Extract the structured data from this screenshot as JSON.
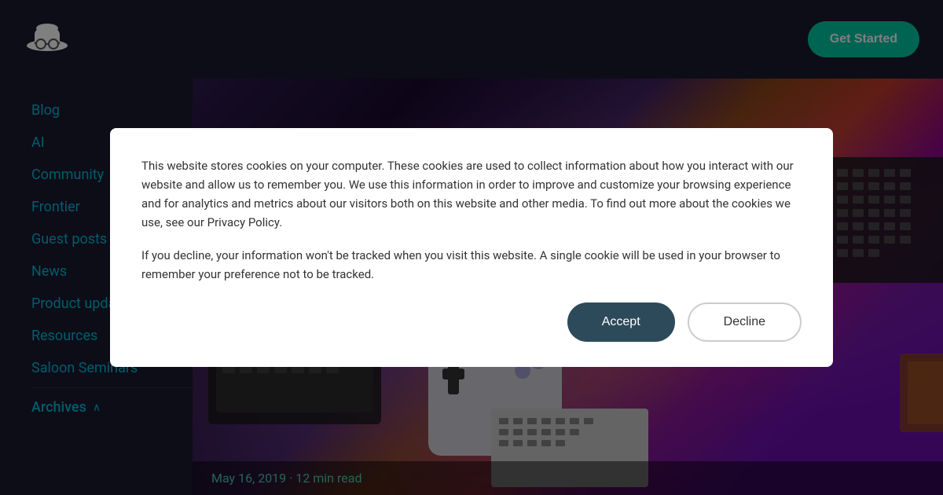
{
  "header": {
    "logo_alt": "Logo",
    "get_started_label": "Get Started"
  },
  "sidebar": {
    "items": [
      {
        "label": "Blog",
        "id": "blog"
      },
      {
        "label": "AI",
        "id": "ai"
      },
      {
        "label": "Community",
        "id": "community"
      },
      {
        "label": "Frontier",
        "id": "frontier"
      },
      {
        "label": "Guest posts",
        "id": "guest-posts"
      },
      {
        "label": "News",
        "id": "news"
      },
      {
        "label": "Product updates",
        "id": "product-updates"
      },
      {
        "label": "Resources",
        "id": "resources"
      },
      {
        "label": "Saloon Seminars",
        "id": "saloon-seminars"
      }
    ],
    "archives_label": "Archives",
    "archives_chevron": "∧"
  },
  "hero": {
    "date": "May 16, 2019",
    "read_time": "12 min read",
    "separator": "·"
  },
  "cookie_modal": {
    "paragraph1": "This website stores cookies on your computer. These cookies are used to collect information about how you interact with our website and allow us to remember you. We use this information in order to improve and customize your browsing experience and for analytics and metrics about our visitors both on this website and other media. To find out more about the cookies we use, see our Privacy Policy.",
    "paragraph2": "If you decline, your information won't be tracked when you visit this website. A single cookie will be used in your browser to remember your preference not to be tracked.",
    "accept_label": "Accept",
    "decline_label": "Decline"
  }
}
